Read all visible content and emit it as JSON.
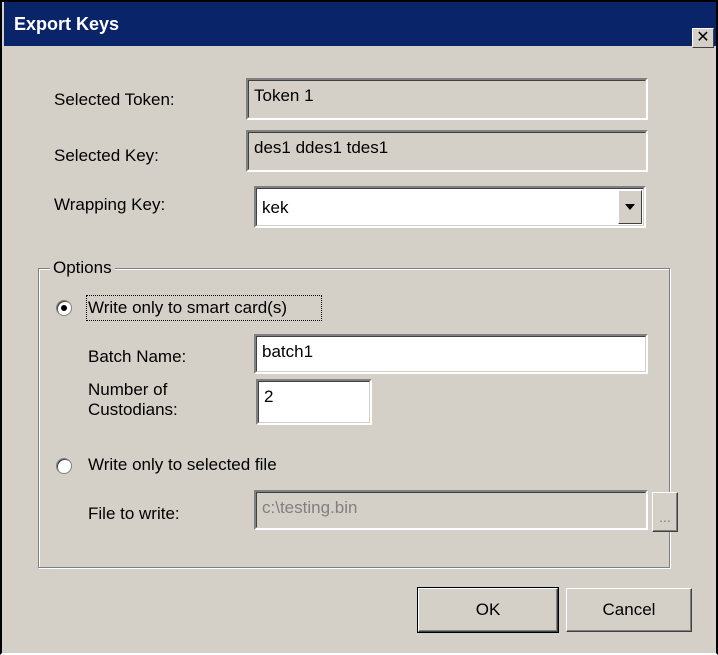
{
  "window": {
    "title": "Export Keys",
    "close_glyph": "✕"
  },
  "fields": {
    "selected_token_label": "Selected Token:",
    "selected_token_value": "Token 1",
    "selected_key_label": "Selected Key:",
    "selected_key_value": "des1 ddes1 tdes1",
    "wrapping_key_label": "Wrapping Key:",
    "wrapping_key_value": "kek"
  },
  "options": {
    "group_label": "Options",
    "smartcard_radio_label": "Write only to smart card(s)",
    "smartcard_selected": true,
    "batch_name_label": "Batch Name:",
    "batch_name_value": "batch1",
    "custodians_label_line1": "Number of",
    "custodians_label_line2": "Custodians:",
    "custodians_value": "2",
    "file_radio_label": "Write only to selected file",
    "file_selected": false,
    "file_to_write_label": "File to write:",
    "file_to_write_value": "c:\\testing.bin",
    "browse_label": "..."
  },
  "buttons": {
    "ok_label": "OK",
    "cancel_label": "Cancel"
  },
  "icons": {
    "close": "close-icon",
    "dropdown": "chevron-down-icon"
  }
}
